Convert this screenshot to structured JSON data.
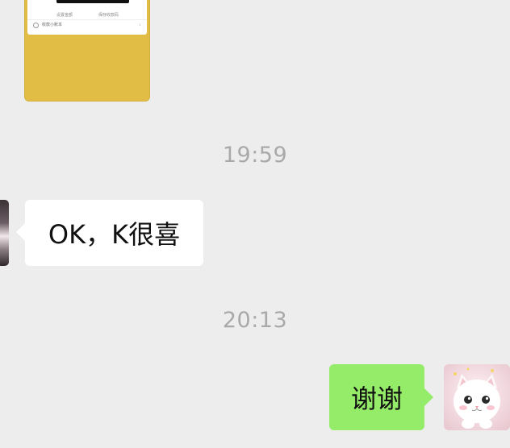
{
  "shared_card": {
    "left_caption": "设置金额",
    "right_caption": "保存收款码",
    "footer_label": "收款小账本"
  },
  "messages": [
    {
      "type": "timestamp",
      "text": "19:59"
    },
    {
      "type": "incoming",
      "text": "OK，K很喜"
    },
    {
      "type": "timestamp",
      "text": "20:13"
    },
    {
      "type": "outgoing",
      "text": "谢谢"
    }
  ],
  "colors": {
    "background": "#ededed",
    "outgoing_bubble": "#95ec69",
    "incoming_bubble": "#ffffff",
    "card": "#e2bd45"
  }
}
